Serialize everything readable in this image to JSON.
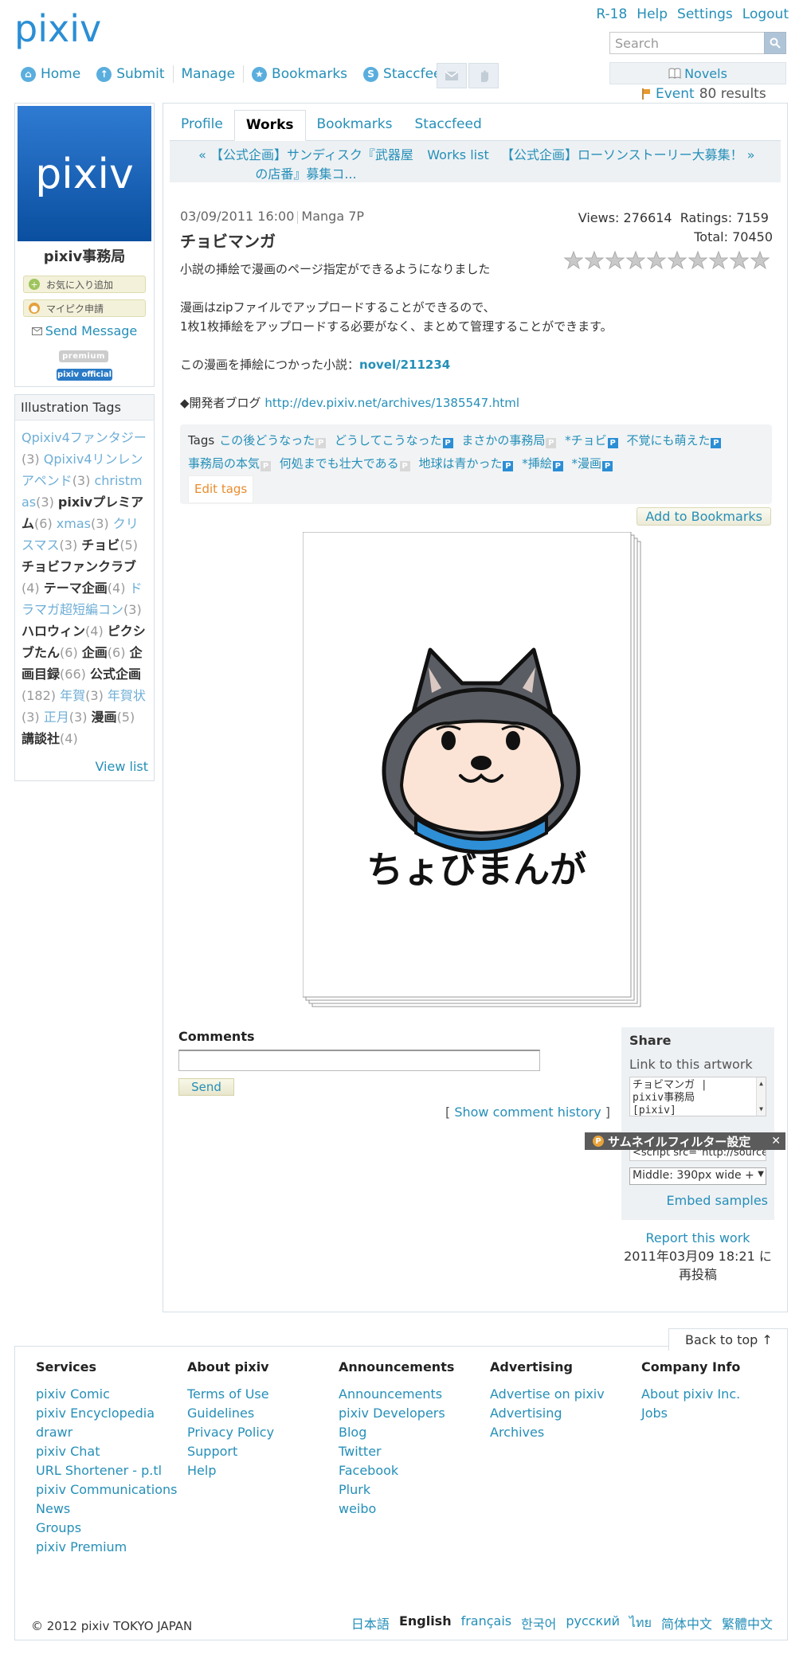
{
  "header": {
    "logo_text": "pixiv",
    "top_links": [
      "R-18",
      "Help",
      "Settings",
      "Logout"
    ],
    "search_placeholder": "Search",
    "nav": [
      "Home",
      "Submit",
      "Manage",
      "Bookmarks",
      "Staccfeed"
    ],
    "novels_label": "Novels",
    "event_label": "Event",
    "event_count": "80 results"
  },
  "profile": {
    "image_text": "pixiv",
    "name": "pixiv事務局",
    "btn_favorite": "お気に入り追加",
    "btn_mypixiv": "マイピク申請",
    "send_message": "Send Message",
    "badge_premium": "premium",
    "badge_official": "pixiv official"
  },
  "illust_tags": {
    "heading": "Illustration Tags",
    "tags": [
      {
        "name": "Qpixiv4ファンタジー",
        "count": "(3)",
        "bold": false
      },
      {
        "name": "Qpixiv4リンレンアペンド",
        "count": "(3)",
        "bold": false
      },
      {
        "name": "christmas",
        "count": "(3)",
        "bold": false
      },
      {
        "name": "pixivプレミアム",
        "count": "(6)",
        "bold": true
      },
      {
        "name": "xmas",
        "count": "(3)",
        "bold": false
      },
      {
        "name": "クリスマス",
        "count": "(3)",
        "bold": false
      },
      {
        "name": "チョビ",
        "count": "(5)",
        "bold": true
      },
      {
        "name": "チョビファンクラブ",
        "count": "(4)",
        "bold": true
      },
      {
        "name": "テーマ企画",
        "count": "(4)",
        "bold": true
      },
      {
        "name": "ドラマガ超短編コン",
        "count": "(3)",
        "bold": false
      },
      {
        "name": "ハロウィン",
        "count": "(4)",
        "bold": true
      },
      {
        "name": "ピクシブたん",
        "count": "(6)",
        "bold": true
      },
      {
        "name": "企画",
        "count": "(6)",
        "bold": true
      },
      {
        "name": "企画目録",
        "count": "(66)",
        "bold": true
      },
      {
        "name": "公式企画",
        "count": "(182)",
        "bold": true
      },
      {
        "name": "年賀",
        "count": "(3)",
        "bold": false
      },
      {
        "name": "年賀状",
        "count": "(3)",
        "bold": false
      },
      {
        "name": "正月",
        "count": "(3)",
        "bold": false
      },
      {
        "name": "漫画",
        "count": "(5)",
        "bold": true
      },
      {
        "name": "講談社",
        "count": "(4)",
        "bold": true
      }
    ],
    "view_list": "View list"
  },
  "tabs": [
    "Profile",
    "Works",
    "Bookmarks",
    "Staccfeed"
  ],
  "pager": {
    "prev": "« 【公式企画】サンディスク『武器屋の店番』募集コ...",
    "list": "Works list",
    "next": "【公式企画】ローソンストーリー大募集！ »"
  },
  "work": {
    "date": "03/09/2011 16:00",
    "type": "Manga 7P",
    "title": "チョビマンガ",
    "views_label": "Views:",
    "views": "276614",
    "ratings_label": "Ratings:",
    "ratings": "7159",
    "total_label": "Total:",
    "total": "70450",
    "rating_stars": 10,
    "caption_1": "小説の挿絵で漫画のページ指定ができるようになりました",
    "caption_2": "漫画はzipファイルでアップロードすることができるので、",
    "caption_3": "1枚1枚挿絵をアップロードする必要がなく、まとめて管理することができます。",
    "caption_4_prefix": "この漫画を挿絵につかった小説：",
    "caption_4_link": "novel/211234",
    "caption_5_prefix": "◆開発者ブログ",
    "caption_5_link": "http://dev.pixiv.net/archives/1385547.html"
  },
  "work_tags": {
    "label": "Tags",
    "tags": [
      {
        "name": "この後どうなった",
        "p": false
      },
      {
        "name": "どうしてこうなった",
        "p": true
      },
      {
        "name": "まさかの事務局",
        "p": false
      },
      {
        "name": "*チョビ",
        "p": true
      },
      {
        "name": "不覚にも萌えた",
        "p": true
      },
      {
        "name": "事務局の本気",
        "p": false
      },
      {
        "name": "何処までも壮大である",
        "p": false
      },
      {
        "name": "地球は青かった",
        "p": true
      },
      {
        "name": "*挿絵",
        "p": true
      },
      {
        "name": "*漫画",
        "p": true
      }
    ],
    "edit": "Edit tags",
    "add_bookmark": "Add to Bookmarks"
  },
  "artwork": {
    "caption": "ちょびまんが"
  },
  "comments": {
    "heading": "Comments",
    "send": "Send",
    "history": "Show comment history"
  },
  "share": {
    "heading": "Share",
    "link_label": "Link to this artwork",
    "link_text": "チョビマンガ |\npixiv事務局\n[pixiv]",
    "embed_code": "<script src=\"http://source",
    "size_option": "Middle: 390px wide + ",
    "embed_samples": "Embed samples",
    "thumb_filter": "サムネイルフィルター設定"
  },
  "report": {
    "link": "Report this work",
    "repost": "2011年03月09 18:21 に再投稿"
  },
  "footer": {
    "back_to_top": "Back to top ↑",
    "columns": [
      {
        "heading": "Services",
        "links": [
          "pixiv Comic",
          "pixiv Encyclopedia",
          "drawr",
          "pixiv Chat",
          "URL Shortener - p.tl",
          "pixiv Communications",
          "News",
          "Groups",
          "pixiv Premium"
        ]
      },
      {
        "heading": "About pixiv",
        "links": [
          "Terms of Use",
          "Guidelines",
          "Privacy Policy",
          "Support",
          "Help"
        ]
      },
      {
        "heading": "Announcements",
        "links": [
          "Announcements",
          "pixiv Developers",
          "Blog",
          "Twitter",
          "Facebook",
          "Plurk",
          "weibo"
        ]
      },
      {
        "heading": "Advertising",
        "links": [
          "Advertise on pixiv",
          "Advertising",
          "Archives"
        ]
      },
      {
        "heading": "Company Info",
        "links": [
          "About pixiv Inc.",
          "Jobs"
        ]
      }
    ],
    "copyright": "© 2012 pixiv TOKYO JAPAN",
    "languages": [
      "日本語",
      "English",
      "français",
      "한국어",
      "русский",
      "ไทย",
      "简体中文",
      "繁體中文"
    ],
    "current_language": "English"
  },
  "colors": {
    "link": "#258fb8",
    "brand": "#2b8ed5",
    "panel_bg": "#eef1f4",
    "border": "#d7dfe5"
  }
}
